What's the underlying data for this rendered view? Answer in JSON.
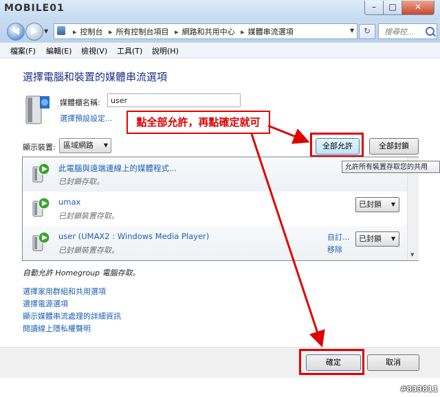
{
  "window": {
    "logo": "MOBILE01",
    "min_glyph": "–",
    "max_glyph": "□",
    "close_glyph": "✕"
  },
  "address": {
    "crumbs": [
      "控制台",
      "所有控制台項目",
      "網路和共用中心",
      "媒體串流選項"
    ],
    "sep": "▸",
    "search_placeholder": "搜尋控..."
  },
  "menu": [
    "檔案(F)",
    "編輯(E)",
    "檢視(V)",
    "工具(T)",
    "說明(H)"
  ],
  "main": {
    "heading": "選擇電腦和裝置的媒體串流選項",
    "library_name_label": "媒體櫃名稱:",
    "library_name_value": "user",
    "default_settings_link": "選擇預設設定...",
    "show_devices_label": "顯示裝置:",
    "network_select": "區域網路",
    "allow_all": "全部允許",
    "block_all": "全部封鎖",
    "tooltip": "允許所有裝置存取您的共用"
  },
  "annotation": "點全部允許，再點確定就可",
  "devices": [
    {
      "title": "此電腦與遠端連線上的媒體程式...",
      "status": "已封鎖存取。",
      "select": "",
      "links": []
    },
    {
      "title": "umax",
      "status": "已封鎖裝置存取。",
      "select": "已封鎖",
      "links": []
    },
    {
      "title": "user (UMAX2 : Windows Media Player)",
      "status": "已封鎖裝置存取。",
      "select": "已封鎖",
      "links": [
        "自訂...",
        "移除"
      ]
    }
  ],
  "auto_allow": "自動允許 Homegroup 電腦存取。",
  "bottom_links": [
    "選擇家用群組和共用選項",
    "選擇電源選項",
    "顯示媒體串流處理的詳細資訊",
    "閱讀線上隱私權聲明"
  ],
  "footer": {
    "ok": "確定",
    "cancel": "取消"
  },
  "watermark": "#833811",
  "colors": {
    "annotation_red": "#e00000",
    "link_blue": "#1b5fb5",
    "heading_blue": "#1e3287"
  },
  "icons": [
    "back-arrow-icon",
    "forward-arrow-icon",
    "control-panel-icon",
    "refresh-icon",
    "search-icon",
    "media-library-icon",
    "media-device-icon"
  ]
}
